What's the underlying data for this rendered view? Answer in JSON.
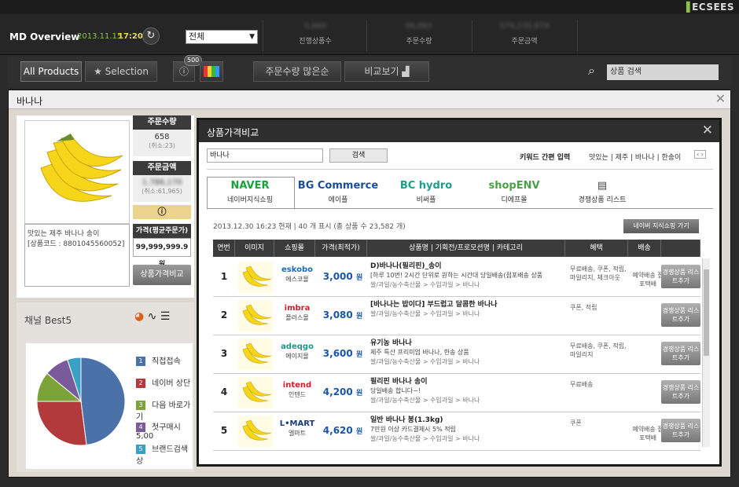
{
  "brand": "ECSEES",
  "header": {
    "title": "MD Overview",
    "date": "2013.11.15",
    "time": "17:20",
    "scope": "전체",
    "stats": [
      {
        "label": "진행상품수",
        "value": "5,660"
      },
      {
        "label": "주문수량",
        "value": "96,881"
      },
      {
        "label": "주문금액",
        "value": "579,235,679"
      }
    ]
  },
  "toolbar": {
    "all_products": "All Products",
    "selection": "★ Selection",
    "badge": "500",
    "sort": "주문수량 많은순",
    "compare": "비교보기",
    "search_placeholder": "상품 검색"
  },
  "panel": {
    "title": "바나나",
    "order_qty_label": "주문수량",
    "order_qty": "658",
    "order_qty_cancel": "(취소:23)",
    "order_amt_label": "주문금액",
    "order_amt": "1,786,170",
    "order_amt_cancel": "(취소:61,965)",
    "desc": "맛있는 제주 바나나 송이",
    "code": "[상품코드 : 8801045560052]",
    "avg_label": "가격(평균주문가)",
    "avg_value": "99,999,999.9 원",
    "compare_btn": "상품가격비교"
  },
  "best5": {
    "title": "채널 Best5",
    "items": [
      {
        "no": "1",
        "label": "직접접속",
        "color": "#4a72a8"
      },
      {
        "no": "2",
        "label": "네이버 상단",
        "color": "#b33a3a"
      },
      {
        "no": "3",
        "label": "다음 바로가기",
        "color": "#7ca23a"
      },
      {
        "no": "4",
        "label": "첫구매시 5,00",
        "color": "#7a5a9a"
      },
      {
        "no": "5",
        "label": "브랜드검색 상",
        "color": "#3aa0c8"
      }
    ],
    "slices": [
      48,
      27,
      11,
      9,
      5
    ]
  },
  "modal": {
    "title": "상품가격비교",
    "search_value": "바나나",
    "search_btn": "검색",
    "kw_label": "키워드 간편 입력",
    "kw_list": "맛있는 | 제주 | 바나나 | 한송이",
    "kw_nav": "‹ ›",
    "tabs": [
      {
        "logo": "NAVER",
        "name": "네이버지식쇼핑",
        "color": "#1aa33a"
      },
      {
        "logo": "BG Commerce",
        "name": "에이플",
        "color": "#1a4e9a"
      },
      {
        "logo": "BC hydro",
        "name": "비써플",
        "color": "#1aa088"
      },
      {
        "logo": "shopENV",
        "name": "디에프몰",
        "color": "#4aa04a"
      },
      {
        "logo": "▤",
        "name": "경쟁상품 리스트",
        "color": "#444"
      }
    ],
    "summary": "2013.12.30 16:23 현재  | 40 개 표시 (총 상품 수 23,582 개)",
    "naver_btn": "네이버 지식쇼핑 가기",
    "columns": [
      "연번",
      "이미지",
      "쇼핑몰",
      "가격(최적가)",
      "상품명 | 기획전/프로모션명 | 카테고리",
      "혜택",
      "배송"
    ],
    "rows": [
      {
        "no": "1",
        "shop_logo": "eskobo",
        "shop_color": "#1a6ab8",
        "shop": "에스코몰",
        "price": "3,000",
        "unit": "원",
        "name": "D)바나나(필리핀)_송이",
        "desc": "[하루 10번! 2시간 단위로 원하는 시간대 당일배송(점포배송 상품",
        "cat": "쌀/과일/농수축산물 > 수입과일 > 바나나",
        "benefit": "무료배송, 쿠폰, 적립, 마일리지, 체크아웃",
        "delivery": "예약배송 점포택배",
        "add": "경쟁상품 리스트추가"
      },
      {
        "no": "2",
        "shop_logo": "imbra",
        "shop_color": "#c8222a",
        "shop": "플러스몰",
        "price": "3,080",
        "unit": "원",
        "name": "[바나나는 밥이다] 부드럽고 달콤한 바나나",
        "desc": "",
        "cat": "쌀/과일/농수축산물 > 수입과일 > 바나나",
        "benefit": "쿠폰, 적립",
        "delivery": "",
        "add": "경쟁상품 리스트추가"
      },
      {
        "no": "3",
        "shop_logo": "adeqgo",
        "shop_color": "#1a9a8a",
        "shop": "에이지몰",
        "price": "3,600",
        "unit": "원",
        "name": "유기농 바나나",
        "desc": "제주 특산 프리미엄 바나나, 한송 상품",
        "cat": "쌀/과일/농수축산물 > 수입과일 > 바나나",
        "benefit": "무료배송, 쿠폰, 적립, 마일리지",
        "delivery": "",
        "add": "경쟁상품 리스트추가"
      },
      {
        "no": "4",
        "shop_logo": "intend",
        "shop_color": "#c8222a",
        "shop": "인텐드",
        "price": "4,200",
        "unit": "원",
        "name": "필리핀 바나나 송이",
        "desc": "당일배송 합니다~!",
        "cat": "쌀/과일/농수축산물 > 수입과일 > 바나나",
        "benefit": "무료배송",
        "delivery": "",
        "add": "경쟁상품 리스트추가"
      },
      {
        "no": "5",
        "shop_logo": "L•MART",
        "shop_color": "#1a3a7a",
        "shop": "엘마트",
        "price": "4,620",
        "unit": "원",
        "name": "일반 바나나 봉(1.3kg)",
        "desc": "7만원 이상 카드결제시 5% 적립",
        "cat": "쌀/과일/농수축산물 > 수입과일 > 바나나",
        "benefit": "쿠폰",
        "delivery": "예약배송 점포택배",
        "add": "경쟁상품 리스트추가"
      }
    ]
  }
}
